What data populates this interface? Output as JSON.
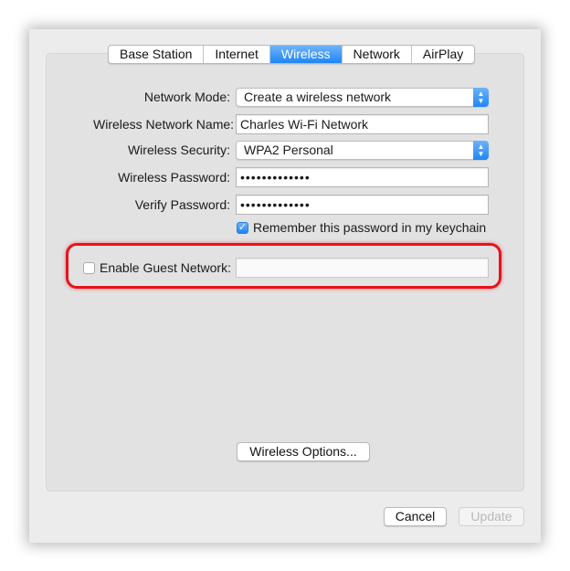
{
  "tabs": [
    "Base Station",
    "Internet",
    "Wireless",
    "Network",
    "AirPlay"
  ],
  "active_tab": "Wireless",
  "network_mode": {
    "label": "Network Mode:",
    "value": "Create a wireless network"
  },
  "network_name": {
    "label": "Wireless Network Name:",
    "value": "Charles Wi-Fi Network"
  },
  "security": {
    "label": "Wireless Security:",
    "value": "WPA2 Personal"
  },
  "password": {
    "label": "Wireless Password:",
    "value": "•••••••••••••"
  },
  "verify_password": {
    "label": "Verify Password:",
    "value": "•••••••••••••"
  },
  "remember_password": {
    "label": "Remember this password in my keychain",
    "checked": true
  },
  "guest_network": {
    "label": "Enable Guest Network:",
    "checked": false,
    "value": ""
  },
  "wireless_options_label": "Wireless Options...",
  "cancel_label": "Cancel",
  "update_label": "Update",
  "highlight_color": "#e8121b",
  "accent_color": "#1f86f5"
}
